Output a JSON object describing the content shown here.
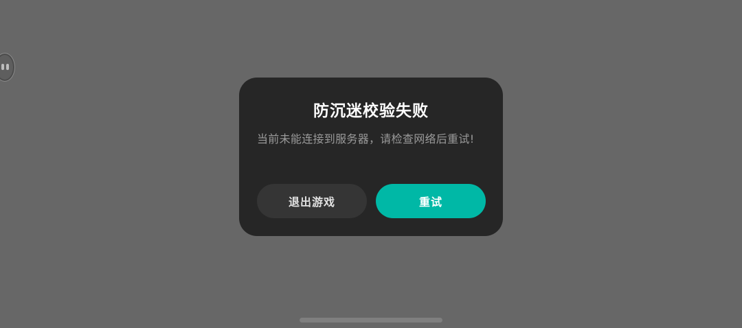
{
  "dialog": {
    "title": "防沉迷校验失败",
    "message": "当前未能连接到服务器，请检查网络后重试!",
    "exit_label": "退出游戏",
    "retry_label": "重试"
  },
  "colors": {
    "accent": "#00b8a6",
    "dialog_bg": "#262626",
    "overlay_bg": "#676767"
  },
  "icons": {
    "floating_ball": "floating-assistant-icon"
  }
}
